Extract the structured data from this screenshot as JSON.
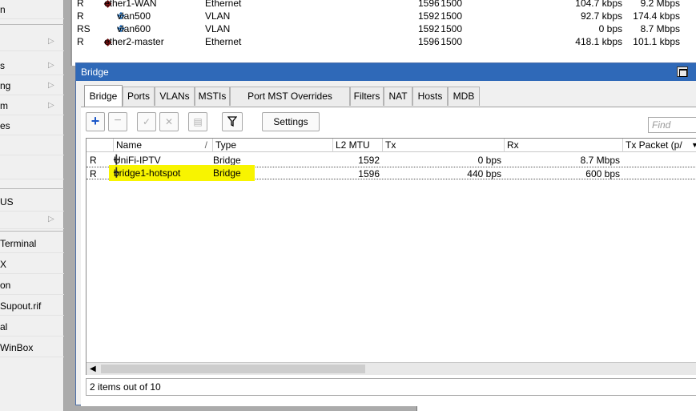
{
  "left_menu": [
    {
      "label": "n",
      "arrow": false
    },
    {
      "label": "",
      "arrow": true
    },
    {
      "label": "s",
      "arrow": true
    },
    {
      "label": "ng",
      "arrow": true
    },
    {
      "label": "m",
      "arrow": true
    },
    {
      "label": "es",
      "arrow": false
    },
    {
      "label": "",
      "arrow": false
    },
    {
      "label": "",
      "arrow": false
    },
    {
      "label": "US",
      "arrow": false
    },
    {
      "label": "",
      "arrow": true
    },
    {
      "label": "Terminal",
      "arrow": false
    },
    {
      "label": "X",
      "arrow": false
    },
    {
      "label": "on",
      "arrow": false
    },
    {
      "label": "Supout.rif",
      "arrow": false
    },
    {
      "label": "al",
      "arrow": false
    },
    {
      "label": "WinBox",
      "arrow": false
    }
  ],
  "interfaces": [
    {
      "flag": "R",
      "name": "ether1-WAN",
      "type": "Ethernet",
      "mtu": "1500",
      "l2mtu": "1596",
      "tx": "104.7 kbps",
      "rx": "9.2 Mbps",
      "kind": "eth"
    },
    {
      "flag": "R",
      "name": "vlan500",
      "type": "VLAN",
      "mtu": "1500",
      "l2mtu": "1592",
      "tx": "92.7 kbps",
      "rx": "174.4 kbps",
      "kind": "vlan"
    },
    {
      "flag": "RS",
      "name": "vlan600",
      "type": "VLAN",
      "mtu": "1500",
      "l2mtu": "1592",
      "tx": "0 bps",
      "rx": "8.7 Mbps",
      "kind": "vlan"
    },
    {
      "flag": "R",
      "name": "ether2-master",
      "type": "Ethernet",
      "mtu": "1500",
      "l2mtu": "1596",
      "tx": "418.1 kbps",
      "rx": "101.1 kbps",
      "kind": "eth"
    }
  ],
  "window": {
    "title": "Bridge",
    "tabs": [
      "Bridge",
      "Ports",
      "VLANs",
      "MSTIs",
      "Port MST Overrides",
      "Filters",
      "NAT",
      "Hosts",
      "MDB"
    ],
    "toolbar": {
      "settings": "Settings"
    },
    "find_placeholder": "Find",
    "columns": [
      "Name",
      "/",
      "Type",
      "L2 MTU",
      "Tx",
      "Rx",
      "Tx Packet (p/"
    ],
    "rows": [
      {
        "flag": "R",
        "name": "UniFi-IPTV",
        "type": "Bridge",
        "l2mtu": "1592",
        "tx": "0 bps",
        "rx": "8.7 Mbps",
        "highlighted": false
      },
      {
        "flag": "R",
        "name": "bridge1-hotspot",
        "type": "Bridge",
        "l2mtu": "1596",
        "tx": "440 bps",
        "rx": "600 bps",
        "highlighted": true
      }
    ],
    "status": "2 items out of 10"
  },
  "colors": {
    "titlebar": "#2f69b8",
    "highlight": "#f8f400",
    "add_icon": "#1a56c8"
  }
}
